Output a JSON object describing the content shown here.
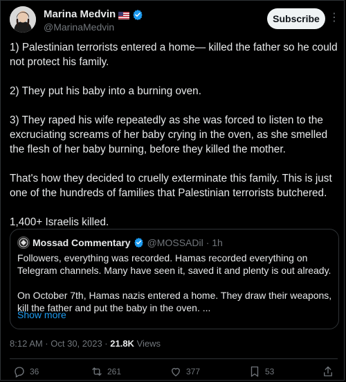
{
  "author": {
    "name": "Marina Medvin",
    "flag": "🇺🇸",
    "handle": "@MarinaMedvin"
  },
  "header": {
    "subscribe_label": "Subscribe",
    "more_label": "⋮"
  },
  "tweet": {
    "paragraphs": [
      "1) Palestinian terrorists entered a home— killed the father so he could not protect his family.",
      "2) They put his baby into a burning oven.",
      "3) They raped his wife repeatedly as she was forced to listen to the excruciating screams of her baby crying in the oven, as she smelled the flesh of her baby burning, before they killed the mother.",
      "That's how they decided to cruelly exterminate this family. This is just one of the hundreds of families that Palestinian terrorists butchered.",
      "1,400+ Israelis killed."
    ]
  },
  "quote": {
    "name": "Mossad Commentary",
    "handle": "@MOSSADil",
    "time": "· 1h",
    "paragraphs": [
      "Followers, everything was recorded. Hamas recorded everything on Telegram channels. Many have seen it, saved it and plenty is out already.",
      "On October 7th, Hamas nazis entered a home. They draw their weapons, kill the father and put the baby in the oven. ..."
    ],
    "show_more": "Show more"
  },
  "meta": {
    "time": "8:12 AM · Oct 30, 2023 · ",
    "views_count": "21.8K",
    "views_label": " Views"
  },
  "actions": {
    "replies": "36",
    "retweets": "261",
    "likes": "377",
    "bookmarks": "53"
  },
  "colors": {
    "background": "#000000",
    "text": "#e7e9ea",
    "muted": "#71767b",
    "accent": "#1d9bf0",
    "border": "#2f3336"
  }
}
